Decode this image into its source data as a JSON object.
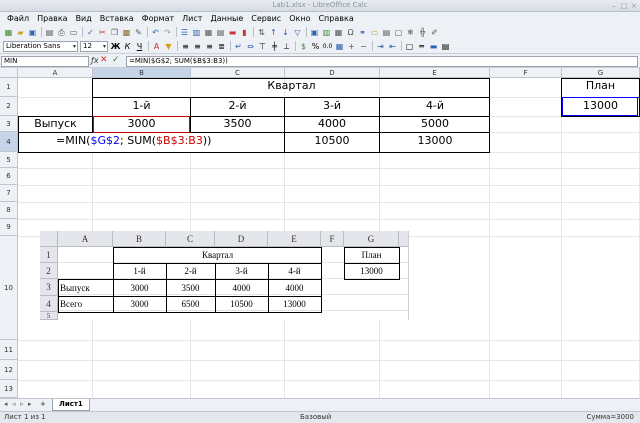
{
  "window": {
    "title": "Lab1.xlsx - LibreOffice Calc"
  },
  "menu": [
    "Файл",
    "Правка",
    "Вид",
    "Вставка",
    "Формат",
    "Лист",
    "Данные",
    "Сервис",
    "Окно",
    "Справка"
  ],
  "toolbar": {
    "font_name": "Liberation Sans",
    "font_size": "12"
  },
  "formula_bar": {
    "name_box": "MIN",
    "formula": "=MIN($G$2; SUM($B$3:B3))"
  },
  "columns": [
    "A",
    "B",
    "C",
    "D",
    "E",
    "F",
    "G"
  ],
  "rows": [
    "1",
    "2",
    "3",
    "4",
    "5",
    "6",
    "7",
    "8",
    "9",
    "10",
    "11",
    "12",
    "13"
  ],
  "cells": {
    "b1": "Квартал",
    "b2": "1-й",
    "c2": "2-й",
    "d2": "3-й",
    "e2": "4-й",
    "a3": "Выпуск",
    "b3": "3000",
    "c3": "3500",
    "d3": "4000",
    "e3": "5000",
    "d4": "10500",
    "e4": "13000",
    "g1": "План",
    "g2": "13000"
  },
  "edit_formula": {
    "p1": "=MIN(",
    "p2": "$G$2",
    "p3": "; SUM(",
    "p4": "$B$3:B3",
    "p5": "))"
  },
  "picture": {
    "cols": [
      "A",
      "B",
      "C",
      "D",
      "E",
      "F",
      "G"
    ],
    "rows": [
      "1",
      "2",
      "3",
      "4",
      "5"
    ],
    "kvartal": "Квартал",
    "q": [
      "1-й",
      "2-й",
      "3-й",
      "4-й"
    ],
    "plan": "План",
    "plan_val": "13000",
    "r3": [
      "Выпуск",
      "3000",
      "3500",
      "4000",
      "4000"
    ],
    "r4": [
      "Всего",
      "3000",
      "6500",
      "10500",
      "13000"
    ]
  },
  "tabs": {
    "sheet": "Лист1"
  },
  "status": {
    "sheet_info": "Лист 1 из 1",
    "style": "Базовый",
    "sum": "Сумма=3000"
  },
  "colors": {
    "accent": "#0045ad",
    "ref_blue": "#0000ff",
    "ref_red": "#cc0000",
    "selection": "#c6d4e8"
  }
}
